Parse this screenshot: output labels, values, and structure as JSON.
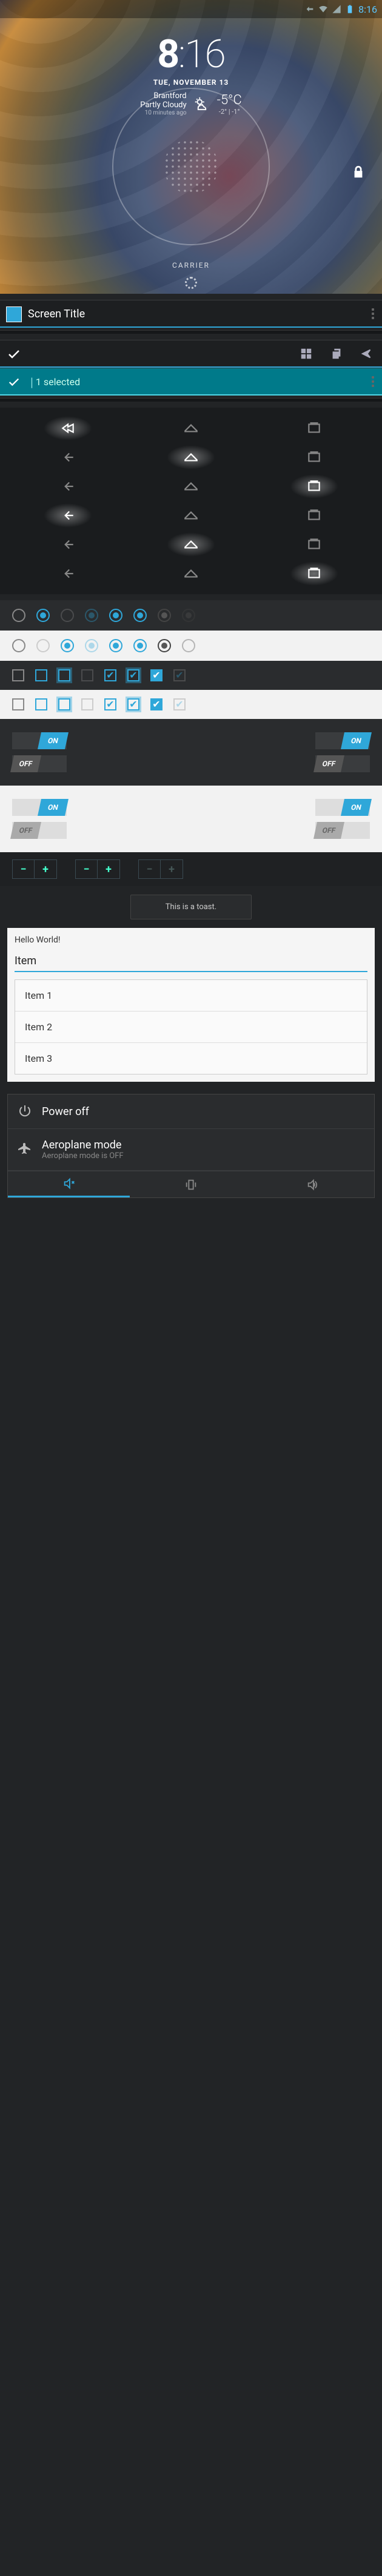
{
  "statusbar": {
    "time": "8:16"
  },
  "lockscreen": {
    "hour": "8",
    "sep": ":",
    "minute": "16",
    "date": "TUE, NOVEMBER 13",
    "location": "Brantford",
    "condition": "Partly Cloudy",
    "updated": "10 minutes ago",
    "temp": "-5°C",
    "range": "-2° | -1°",
    "carrier": "CARRIER"
  },
  "actionbar": {
    "title": "Screen Title",
    "selected": "1 selected"
  },
  "switches": {
    "on": "ON",
    "off": "OFF"
  },
  "stepper": {
    "minus": "−",
    "plus": "+"
  },
  "toast": "This is a toast.",
  "card": {
    "header": "Hello World!",
    "input_value": "Item",
    "items": [
      "Item 1",
      "Item 2",
      "Item 3"
    ]
  },
  "menu": {
    "power": "Power off",
    "airplane_title": "Aeroplane mode",
    "airplane_sub": "Aeroplane mode is OFF"
  }
}
